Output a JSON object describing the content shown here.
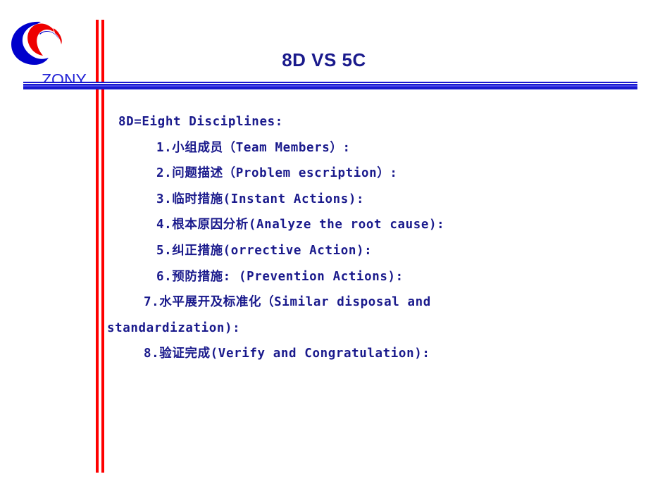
{
  "slide": {
    "brand": {
      "wordmark": "ZONY",
      "logo_icon": "zony-crescent-logo",
      "logo_blue": "#0000cc",
      "logo_red": "#ee0000",
      "wordmark_color": "#2424d6"
    },
    "title": "8D VS 5C",
    "title_color": "#1a1a8c",
    "accent_rule_color": "#1818cf",
    "vertical_rule_color": "#fe0000",
    "body": {
      "lead": "8D=Eight Disciplines:",
      "items": [
        "1.小组成员（Team Members）:",
        "2.问题描述（Problem escription）:",
        "3.临时措施(Instant Actions):",
        "4.根本原因分析(Analyze the root cause):",
        "5.纠正措施(orrective Action):",
        "6.预防措施: (Prevention Actions):",
        "7.水平展开及标准化（Similar disposal and",
        "standardization):",
        "8.验证完成(Verify and Congratulation):"
      ],
      "text_color": "#1a1a8c"
    }
  }
}
